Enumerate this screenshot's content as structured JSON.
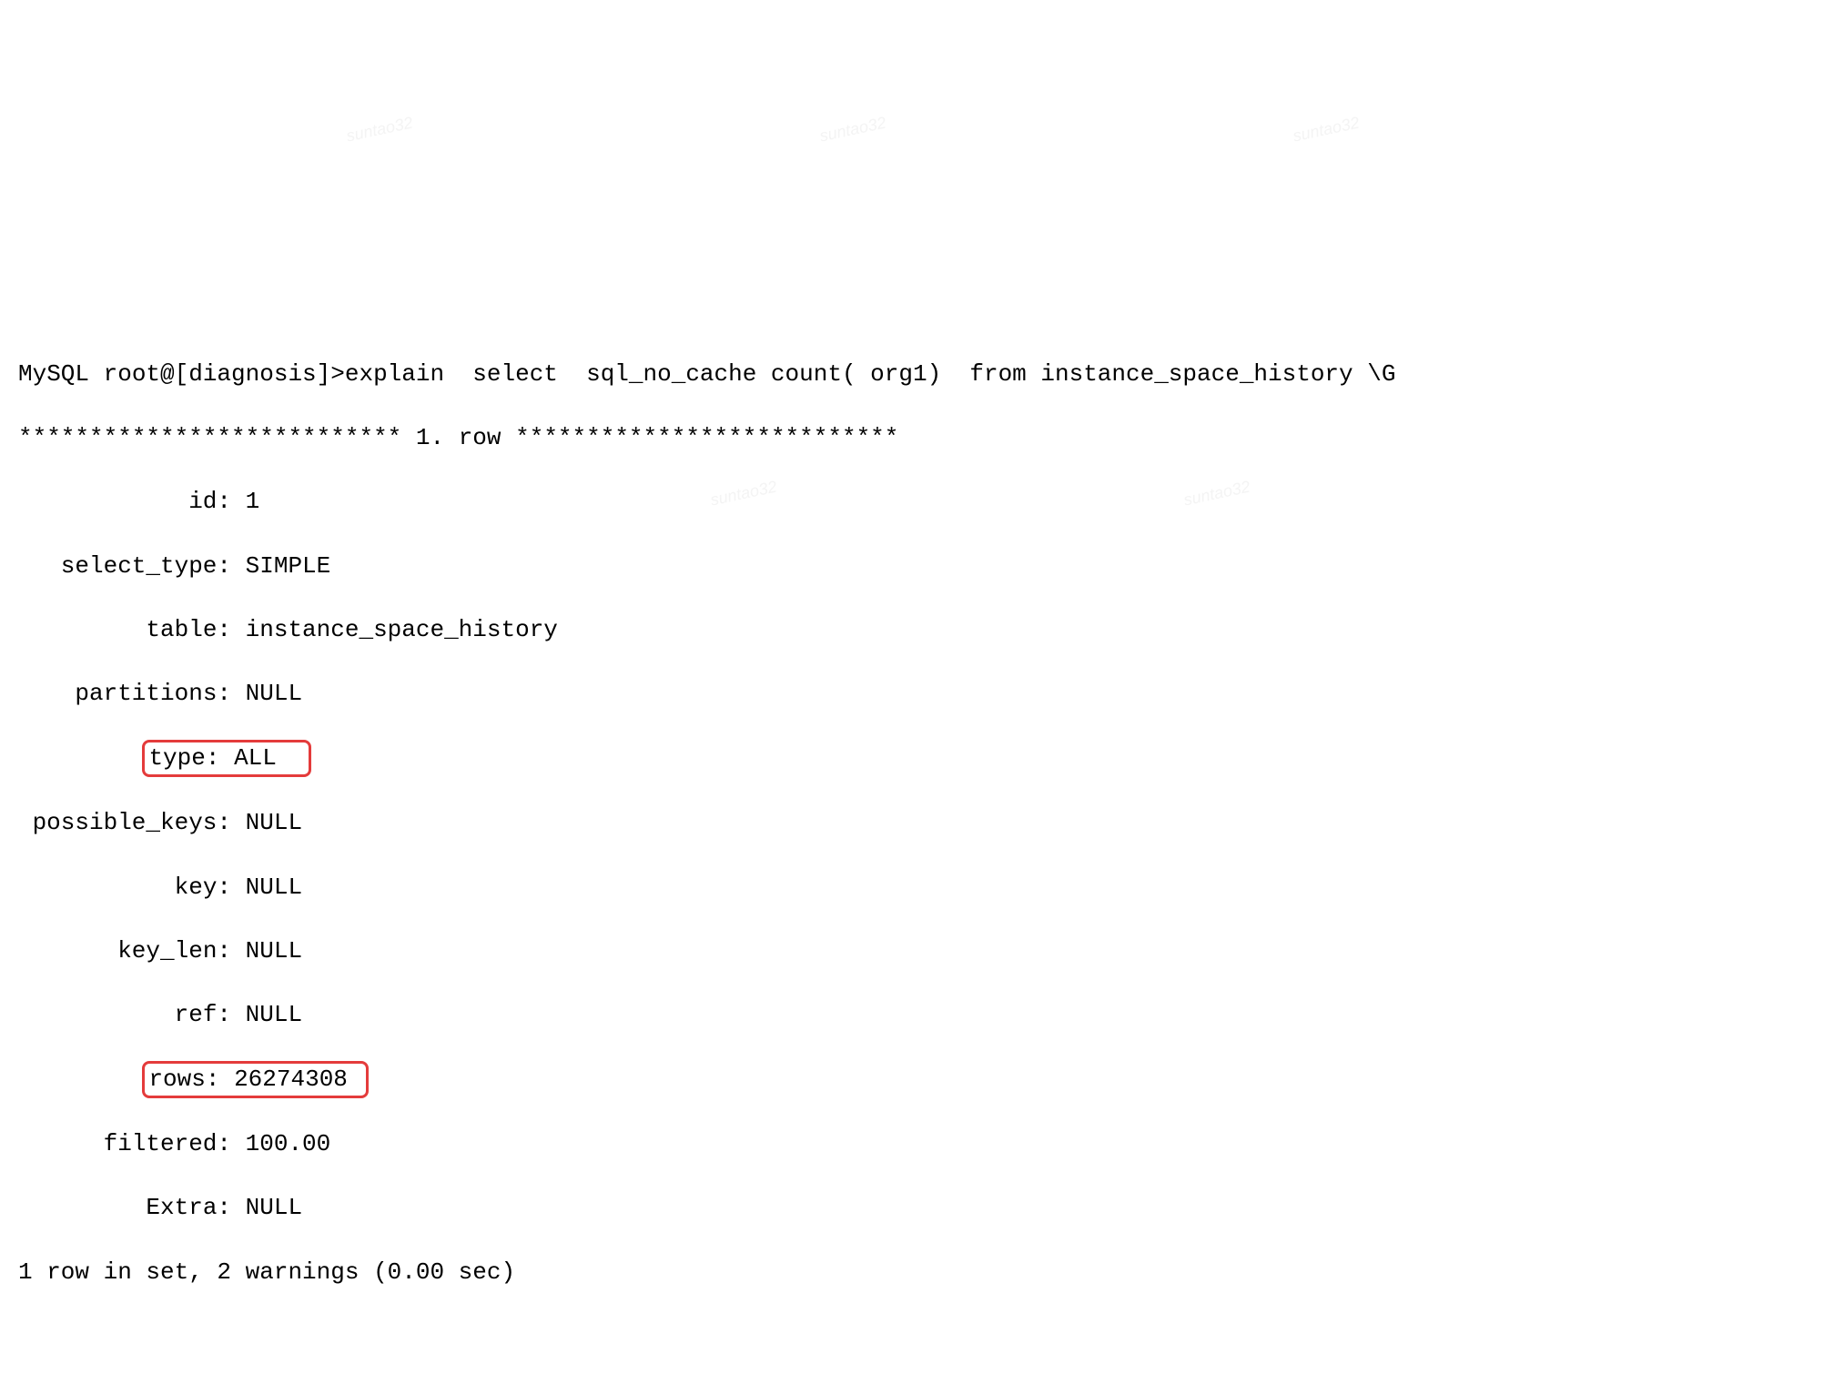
{
  "prompt": "MySQL root@[diagnosis]>explain  select  sql_no_cache count( org1)  from instance_space_history \\G",
  "header_stars_left": "***************************",
  "header_row": " 1. row ",
  "header_stars_right": "***************************",
  "fields": {
    "id": {
      "label": "id",
      "value": "1"
    },
    "select_type": {
      "label": "select_type",
      "value": "SIMPLE"
    },
    "table": {
      "label": "table",
      "value": "instance_space_history"
    },
    "partitions": {
      "label": "partitions",
      "value": "NULL"
    },
    "type": {
      "label": "type",
      "value": "ALL"
    },
    "possible_keys": {
      "label": "possible_keys",
      "value": "NULL"
    },
    "key": {
      "label": "key",
      "value": "NULL"
    },
    "key_len": {
      "label": "key_len",
      "value": "NULL"
    },
    "ref": {
      "label": "ref",
      "value": "NULL"
    },
    "rows": {
      "label": "rows",
      "value": "26274308"
    },
    "filtered": {
      "label": "filtered",
      "value": "100.00"
    },
    "extra": {
      "label": "Extra",
      "value": "NULL"
    }
  },
  "footer": "1 row in set, 2 warnings (0.00 sec)",
  "separator": ": ",
  "indent_for_highlight": "         ",
  "watermark": "suntao32"
}
